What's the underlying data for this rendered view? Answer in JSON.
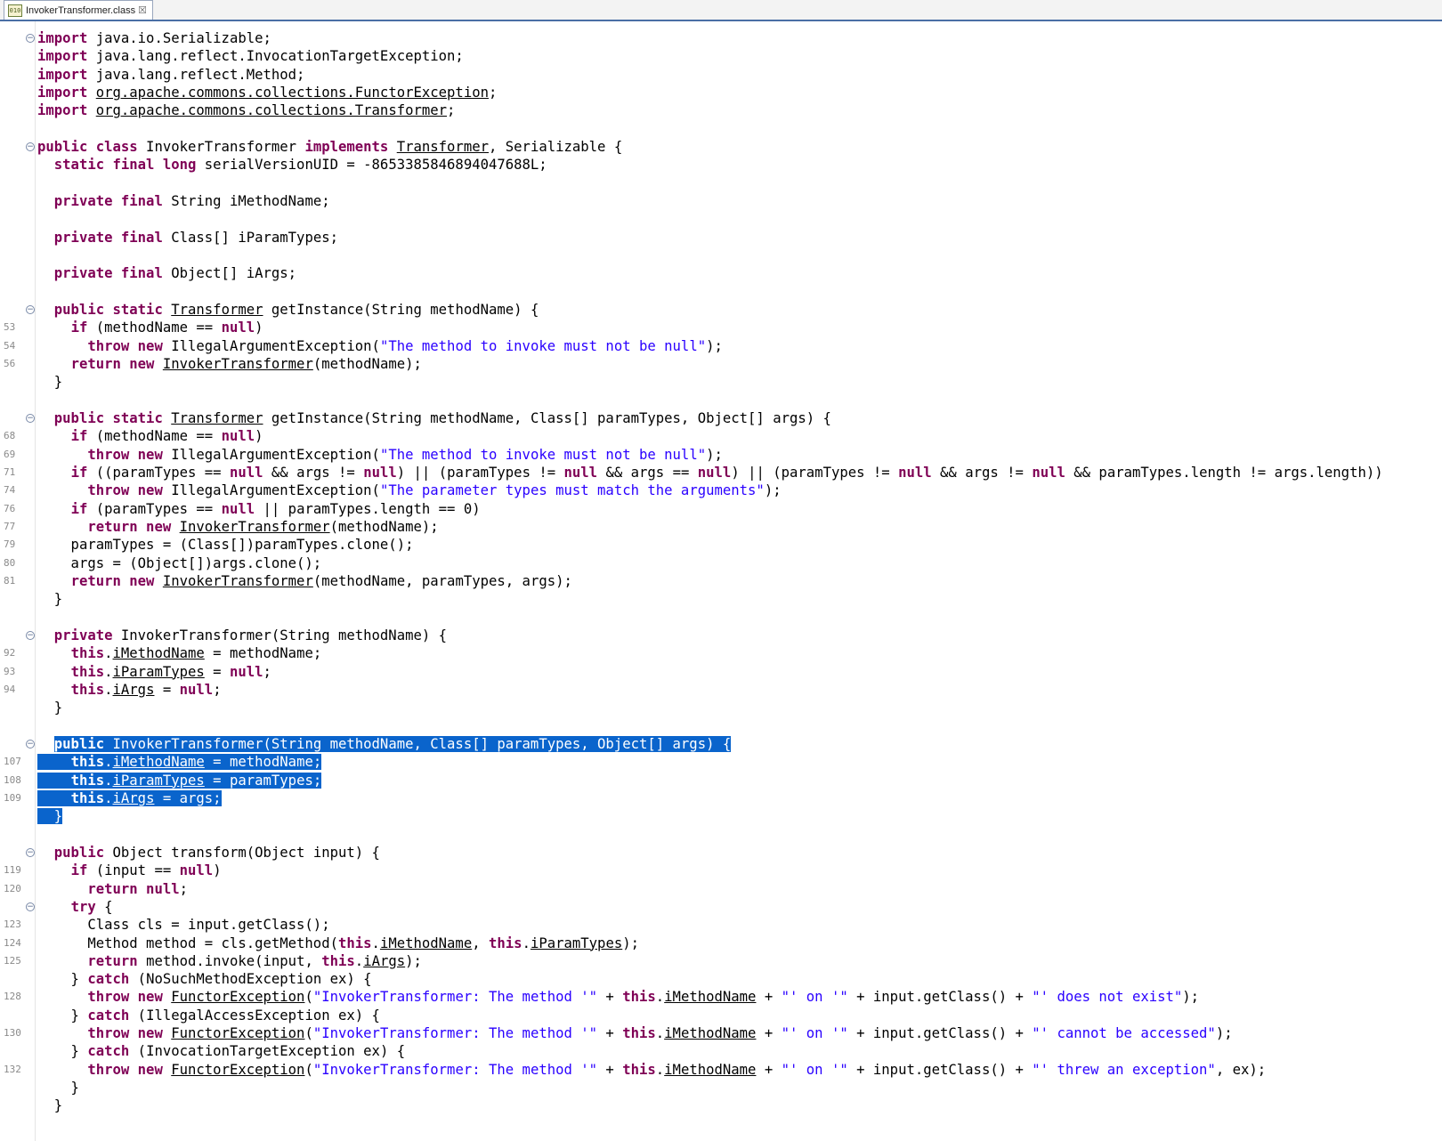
{
  "tab": {
    "icon": "class-file-icon",
    "title": "InvokerTransformer.class",
    "close": "☒"
  },
  "lines": [
    {
      "n": "",
      "fold": "⊖",
      "html": "<span class='kw'>import</span> java.io.Serializable;"
    },
    {
      "n": "",
      "fold": "",
      "html": "<span class='kw'>import</span> java.lang.reflect.InvocationTargetException;"
    },
    {
      "n": "",
      "fold": "",
      "html": "<span class='kw'>import</span> java.lang.reflect.Method;"
    },
    {
      "n": "",
      "fold": "",
      "html": "<span class='kw'>import</span> <span class='ul'>org.apache.commons.collections.FunctorException</span>;"
    },
    {
      "n": "",
      "fold": "",
      "html": "<span class='kw'>import</span> <span class='ul'>org.apache.commons.collections.Transformer</span>;"
    },
    {
      "n": "",
      "fold": "",
      "html": ""
    },
    {
      "n": "",
      "fold": "⊖",
      "html": "<span class='kw'>public class</span> InvokerTransformer <span class='kw'>implements</span> <span class='ul'>Transformer</span>, Serializable {"
    },
    {
      "n": "",
      "fold": "",
      "html": "  <span class='kw'>static final long</span> serialVersionUID = -8653385846894047688L;"
    },
    {
      "n": "",
      "fold": "",
      "html": ""
    },
    {
      "n": "",
      "fold": "",
      "html": "  <span class='kw'>private final</span> String iMethodName;"
    },
    {
      "n": "",
      "fold": "",
      "html": ""
    },
    {
      "n": "",
      "fold": "",
      "html": "  <span class='kw'>private final</span> Class[] iParamTypes;"
    },
    {
      "n": "",
      "fold": "",
      "html": ""
    },
    {
      "n": "",
      "fold": "",
      "html": "  <span class='kw'>private final</span> Object[] iArgs;"
    },
    {
      "n": "",
      "fold": "",
      "html": ""
    },
    {
      "n": "",
      "fold": "⊖",
      "html": "  <span class='kw'>public static</span> <span class='ul'>Transformer</span> getInstance(String methodName) {"
    },
    {
      "n": "53",
      "fold": "",
      "html": "    <span class='kw'>if</span> (methodName == <span class='kw'>null</span>)"
    },
    {
      "n": "54",
      "fold": "",
      "html": "      <span class='kw'>throw new</span> IllegalArgumentException(<span class='str'>\"The method to invoke must not be null\"</span>);"
    },
    {
      "n": "56",
      "fold": "",
      "html": "    <span class='kw'>return new</span> <span class='ul'>InvokerTransformer</span>(methodName);"
    },
    {
      "n": "",
      "fold": "",
      "html": "  }"
    },
    {
      "n": "",
      "fold": "",
      "html": ""
    },
    {
      "n": "",
      "fold": "⊖",
      "html": "  <span class='kw'>public static</span> <span class='ul'>Transformer</span> getInstance(String methodName, Class[] paramTypes, Object[] args) {"
    },
    {
      "n": "68",
      "fold": "",
      "html": "    <span class='kw'>if</span> (methodName == <span class='kw'>null</span>)"
    },
    {
      "n": "69",
      "fold": "",
      "html": "      <span class='kw'>throw new</span> IllegalArgumentException(<span class='str'>\"The method to invoke must not be null\"</span>);"
    },
    {
      "n": "71",
      "fold": "",
      "html": "    <span class='kw'>if</span> ((paramTypes == <span class='kw'>null</span> &amp;&amp; args != <span class='kw'>null</span>) || (paramTypes != <span class='kw'>null</span> &amp;&amp; args == <span class='kw'>null</span>) || (paramTypes != <span class='kw'>null</span> &amp;&amp; args != <span class='kw'>null</span> &amp;&amp; paramTypes.length != args.length))"
    },
    {
      "n": "74",
      "fold": "",
      "html": "      <span class='kw'>throw new</span> IllegalArgumentException(<span class='str'>\"The parameter types must match the arguments\"</span>);"
    },
    {
      "n": "76",
      "fold": "",
      "html": "    <span class='kw'>if</span> (paramTypes == <span class='kw'>null</span> || paramTypes.length == 0)"
    },
    {
      "n": "77",
      "fold": "",
      "html": "      <span class='kw'>return new</span> <span class='ul'>InvokerTransformer</span>(methodName);"
    },
    {
      "n": "79",
      "fold": "",
      "html": "    paramTypes = (Class[])paramTypes.clone();"
    },
    {
      "n": "80",
      "fold": "",
      "html": "    args = (Object[])args.clone();"
    },
    {
      "n": "81",
      "fold": "",
      "html": "    <span class='kw'>return new</span> <span class='ul'>InvokerTransformer</span>(methodName, paramTypes, args);"
    },
    {
      "n": "",
      "fold": "",
      "html": "  }"
    },
    {
      "n": "",
      "fold": "",
      "html": ""
    },
    {
      "n": "",
      "fold": "⊖",
      "html": "  <span class='kw'>private</span> InvokerTransformer(String methodName) {"
    },
    {
      "n": "92",
      "fold": "",
      "html": "    <span class='kw'>this</span>.<span class='ul'>iMethodName</span> = methodName;"
    },
    {
      "n": "93",
      "fold": "",
      "html": "    <span class='kw'>this</span>.<span class='ul'>iParamTypes</span> = <span class='kw'>null</span>;"
    },
    {
      "n": "94",
      "fold": "",
      "html": "    <span class='kw'>this</span>.<span class='ul'>iArgs</span> = <span class='kw'>null</span>;"
    },
    {
      "n": "",
      "fold": "",
      "html": "  }"
    },
    {
      "n": "",
      "fold": "",
      "html": ""
    },
    {
      "n": "",
      "fold": "⊖",
      "sel": true,
      "html": "  <span class='sel'><span class='kw'>public</span> InvokerTransformer(String methodName, Class[] paramTypes, Object[] args) {</span>"
    },
    {
      "n": "107",
      "fold": "",
      "sel": true,
      "html": "<span class='sel'>    <span class='kw'>this</span>.<span class='ul'>iMethodName</span> = methodName;</span>"
    },
    {
      "n": "108",
      "fold": "",
      "sel": true,
      "html": "<span class='sel'>    <span class='kw'>this</span>.<span class='ul'>iParamTypes</span> = paramTypes;</span>"
    },
    {
      "n": "109",
      "fold": "",
      "sel": true,
      "html": "<span class='sel'>    <span class='kw'>this</span>.<span class='ul'>iArgs</span> = args;</span>"
    },
    {
      "n": "",
      "fold": "",
      "sel": true,
      "html": "<span class='sel'>  }</span>"
    },
    {
      "n": "",
      "fold": "",
      "html": ""
    },
    {
      "n": "",
      "fold": "⊖",
      "html": "  <span class='kw'>public</span> Object transform(Object input) {"
    },
    {
      "n": "119",
      "fold": "",
      "html": "    <span class='kw'>if</span> (input == <span class='kw'>null</span>)"
    },
    {
      "n": "120",
      "fold": "",
      "html": "      <span class='kw'>return null</span>;"
    },
    {
      "n": "",
      "fold": "⊖",
      "html": "    <span class='kw'>try</span> {"
    },
    {
      "n": "123",
      "fold": "",
      "html": "      Class cls = input.getClass();"
    },
    {
      "n": "124",
      "fold": "",
      "html": "      Method method = cls.getMethod(<span class='kw'>this</span>.<span class='ul'>iMethodName</span>, <span class='kw'>this</span>.<span class='ul'>iParamTypes</span>);"
    },
    {
      "n": "125",
      "fold": "",
      "html": "      <span class='kw'>return</span> method.invoke(input, <span class='kw'>this</span>.<span class='ul'>iArgs</span>);"
    },
    {
      "n": "",
      "fold": "",
      "html": "    } <span class='kw'>catch</span> (NoSuchMethodException ex) {"
    },
    {
      "n": "128",
      "fold": "",
      "html": "      <span class='kw'>throw new</span> <span class='ul'>FunctorException</span>(<span class='str'>\"InvokerTransformer: The method '\"</span> + <span class='kw'>this</span>.<span class='ul'>iMethodName</span> + <span class='str'>\"' on '\"</span> + input.getClass() + <span class='str'>\"' does not exist\"</span>);"
    },
    {
      "n": "",
      "fold": "",
      "html": "    } <span class='kw'>catch</span> (IllegalAccessException ex) {"
    },
    {
      "n": "130",
      "fold": "",
      "html": "      <span class='kw'>throw new</span> <span class='ul'>FunctorException</span>(<span class='str'>\"InvokerTransformer: The method '\"</span> + <span class='kw'>this</span>.<span class='ul'>iMethodName</span> + <span class='str'>\"' on '\"</span> + input.getClass() + <span class='str'>\"' cannot be accessed\"</span>);"
    },
    {
      "n": "",
      "fold": "",
      "html": "    } <span class='kw'>catch</span> (InvocationTargetException ex) {"
    },
    {
      "n": "132",
      "fold": "",
      "html": "      <span class='kw'>throw new</span> <span class='ul'>FunctorException</span>(<span class='str'>\"InvokerTransformer: The method '\"</span> + <span class='kw'>this</span>.<span class='ul'>iMethodName</span> + <span class='str'>\"' on '\"</span> + input.getClass() + <span class='str'>\"' threw an exception\"</span>, ex);"
    },
    {
      "n": "",
      "fold": "",
      "html": "    }"
    },
    {
      "n": "",
      "fold": "",
      "html": "  }"
    }
  ]
}
